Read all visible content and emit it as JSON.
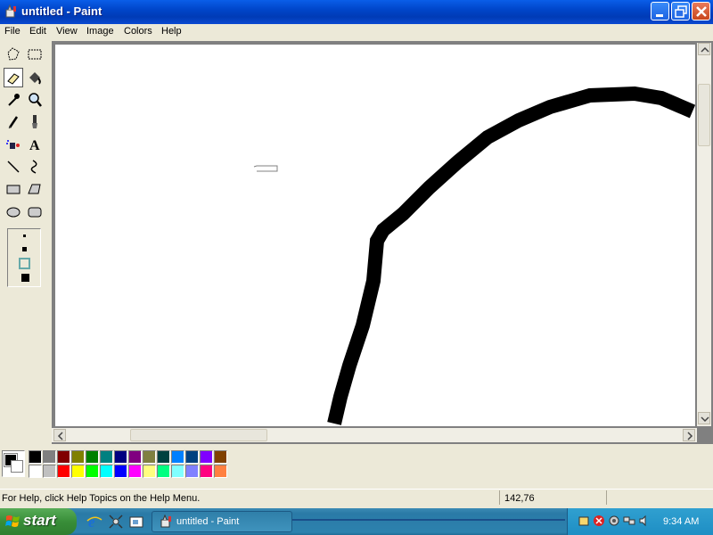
{
  "window": {
    "title": "untitled - Paint",
    "icons": {
      "app": "paint-app-icon",
      "minimize": "minimize-icon",
      "maximize": "maximize-icon",
      "close": "close-icon"
    }
  },
  "menu": {
    "items": [
      "File",
      "Edit",
      "View",
      "Image",
      "Colors",
      "Help"
    ]
  },
  "toolbox": {
    "tools": [
      "free-form-select",
      "rectangle-select",
      "eraser",
      "fill-with-color",
      "pick-color",
      "magnifier",
      "pencil",
      "brush",
      "airbrush",
      "text",
      "line",
      "curve",
      "rectangle",
      "polygon",
      "ellipse",
      "rounded-rectangle"
    ],
    "active_tool": "eraser"
  },
  "palette": {
    "foreground": "#000000",
    "background": "#ffffff",
    "top_row": [
      "#000000",
      "#808080",
      "#800000",
      "#808000",
      "#008000",
      "#008080",
      "#000080",
      "#800080",
      "#808040",
      "#004040",
      "#0080ff",
      "#004080",
      "#8000ff",
      "#804000"
    ],
    "bottom_row": [
      "#ffffff",
      "#c0c0c0",
      "#ff0000",
      "#ffff00",
      "#00ff00",
      "#00ffff",
      "#0000ff",
      "#ff00ff",
      "#ffff80",
      "#00ff80",
      "#80ffff",
      "#8080ff",
      "#ff0080",
      "#ff8040"
    ]
  },
  "status": {
    "help_text": "For Help, click Help Topics on the Help Menu.",
    "coordinates": "142,76"
  },
  "taskbar": {
    "start_label": "start",
    "task_label": "untitled - Paint",
    "clock": "9:34 AM"
  }
}
